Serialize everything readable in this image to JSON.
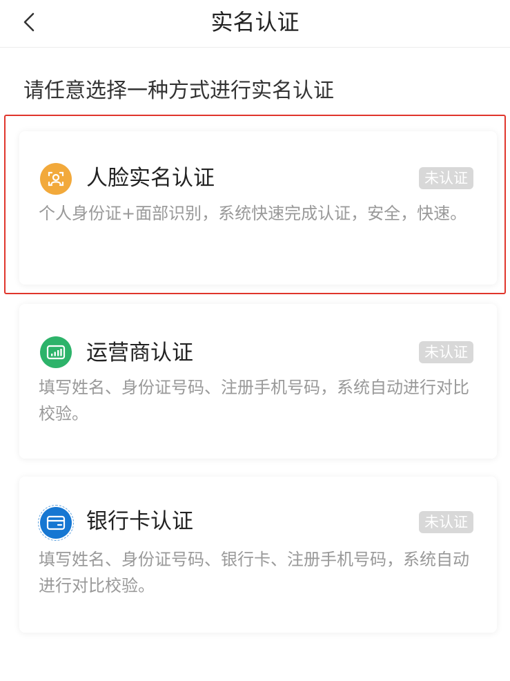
{
  "nav": {
    "title": "实名认证",
    "back_icon": "chevron-left-icon"
  },
  "instruction": "请任意选择一种方式进行实名认证",
  "methods": [
    {
      "title": "人脸实名认证",
      "status": "未认证",
      "description": "个人身份证+面部识别，系统快速完成认证，安全，快速。",
      "icon": "face-scan-icon",
      "icon_color": "#f2a93b",
      "highlighted": true
    },
    {
      "title": "运营商认证",
      "status": "未认证",
      "description": "填写姓名、身份证号码、注册手机号码，系统自动进行对比校验。",
      "icon": "signal-icon",
      "icon_color": "#2db36a"
    },
    {
      "title": "银行卡认证",
      "status": "未认证",
      "description": "填写姓名、身份证号码、银行卡、注册手机号码，系统自动进行对比校验。",
      "icon": "bank-card-icon",
      "icon_color": "#1677d2"
    }
  ],
  "colors": {
    "highlight_border": "#e0352b",
    "badge_background": "#d8d8d8",
    "description_text": "#999999"
  }
}
